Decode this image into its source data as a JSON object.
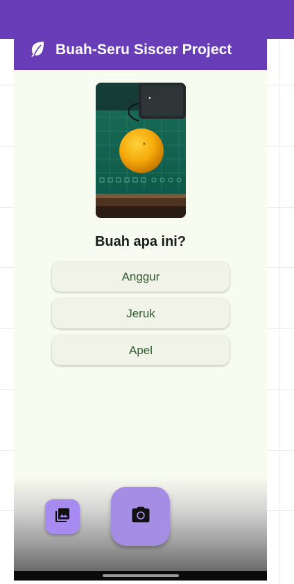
{
  "app": {
    "title": "Buah-Seru Siscer Project",
    "logo_icon": "leaf-icon",
    "brand_color": "#6a3db8"
  },
  "quiz": {
    "photo_alt": "orange-on-cutting-mat",
    "question": "Buah apa ini?",
    "options": [
      {
        "label": "Anggur"
      },
      {
        "label": "Jeruk"
      },
      {
        "label": "Apel"
      }
    ]
  },
  "actions": {
    "gallery_icon": "photo-library-icon",
    "camera_icon": "camera-icon",
    "fab_color": "#a58de6"
  }
}
